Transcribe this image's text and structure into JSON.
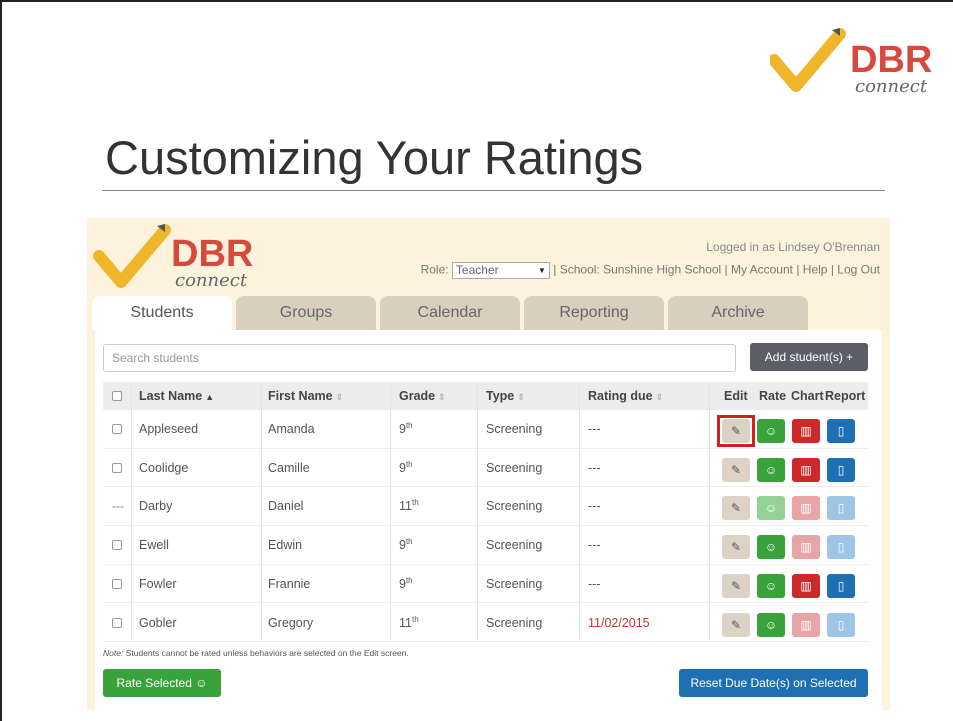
{
  "slide": {
    "title": "Customizing Your Ratings",
    "logo_text": "DBR",
    "logo_subtext": "connect"
  },
  "app": {
    "logo_text": "DBR",
    "logo_subtext": "connect",
    "login_info": "Logged in as Lindsey O'Brennan",
    "role_label": "Role:",
    "role_value": "Teacher",
    "school": "| School: Sunshine High School |",
    "my_account": "My Account",
    "sep1": "|",
    "help": "Help",
    "sep2": "|",
    "logout": "Log Out",
    "tabs": [
      {
        "label": "Students"
      },
      {
        "label": "Groups"
      },
      {
        "label": "Calendar"
      },
      {
        "label": "Reporting"
      },
      {
        "label": "Archive"
      }
    ],
    "search_placeholder": "Search students",
    "add_button": "Add student(s) +",
    "columns": {
      "last_name": "Last Name",
      "first_name": "First Name",
      "grade": "Grade",
      "type": "Type",
      "rating_due": "Rating due",
      "edit": "Edit",
      "rate": "Rate",
      "chart": "Chart",
      "report": "Report"
    },
    "rows": [
      {
        "last": "Appleseed",
        "first": "Amanda",
        "grade": "9",
        "grade_sup": "th",
        "type": "Screening",
        "due": "---"
      },
      {
        "last": "Coolidge",
        "first": "Camille",
        "grade": "9",
        "grade_sup": "th",
        "type": "Screening",
        "due": "---"
      },
      {
        "last": "Darby",
        "first": "Daniel",
        "grade": "11",
        "grade_sup": "th",
        "type": "Screening",
        "due": "---",
        "checkbox": "---"
      },
      {
        "last": "Ewell",
        "first": "Edwin",
        "grade": "9",
        "grade_sup": "th",
        "type": "Screening",
        "due": "---"
      },
      {
        "last": "Fowler",
        "first": "Frannie",
        "grade": "9",
        "grade_sup": "th",
        "type": "Screening",
        "due": "---"
      },
      {
        "last": "Gobler",
        "first": "Gregory",
        "grade": "11",
        "grade_sup": "th",
        "type": "Screening",
        "due": "11/02/2015"
      }
    ],
    "note_label": "Note:",
    "note_text": "Students cannot be rated unless behaviors are selected on the Edit screen.",
    "rate_selected": "Rate Selected ☺",
    "reset_button": "Reset Due Date(s) on Selected"
  },
  "colors": {
    "accent_blue": "#1f6fb4",
    "rate_green": "#3aa23a",
    "chart_red": "#cc2a2a",
    "highlight_red": "#d21f1f",
    "app_bg": "#fdf3dd"
  },
  "icons": {
    "edit": "pencil-icon",
    "rate": "smiley-icon",
    "chart": "bar-chart-icon",
    "report": "document-icon"
  }
}
